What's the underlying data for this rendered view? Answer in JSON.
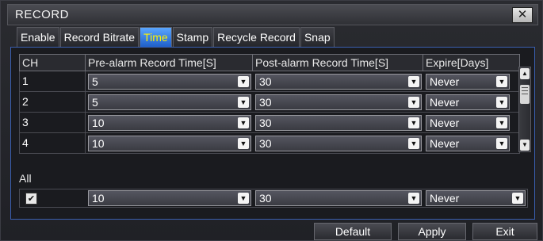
{
  "window": {
    "title": "RECORD",
    "close_glyph": "✕"
  },
  "tabs": [
    {
      "label": "Enable",
      "active": false
    },
    {
      "label": "Record Bitrate",
      "active": false
    },
    {
      "label": "Time",
      "active": true
    },
    {
      "label": "Stamp",
      "active": false
    },
    {
      "label": "Recycle Record",
      "active": false
    },
    {
      "label": "Snap",
      "active": false
    }
  ],
  "table": {
    "headers": [
      "CH",
      "Pre-alarm Record Time[S]",
      "Post-alarm Record Time[S]",
      "Expire[Days]"
    ],
    "rows": [
      {
        "ch": "1",
        "pre": "5",
        "post": "30",
        "expire": "Never"
      },
      {
        "ch": "2",
        "pre": "5",
        "post": "30",
        "expire": "Never"
      },
      {
        "ch": "3",
        "pre": "10",
        "post": "30",
        "expire": "Never"
      },
      {
        "ch": "4",
        "pre": "10",
        "post": "30",
        "expire": "Never"
      }
    ]
  },
  "all": {
    "label": "All",
    "checked": true,
    "pre": "10",
    "post": "30",
    "expire": "Never"
  },
  "buttons": {
    "default": "Default",
    "apply": "Apply",
    "exit": "Exit"
  },
  "colors": {
    "active_tab_bg": "#2f7de0",
    "active_tab_text": "#fff200",
    "panel_border": "#3a5fb0"
  }
}
